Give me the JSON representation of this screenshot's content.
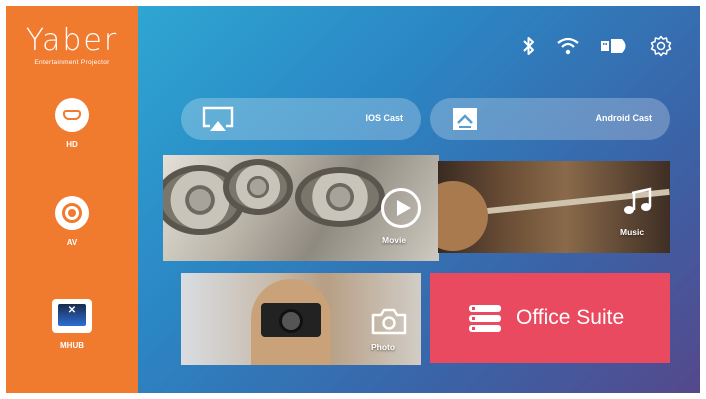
{
  "brand": {
    "name": "Yaber",
    "tagline": "Entertainment Projector",
    "accent_color": "#f07a2e"
  },
  "sidebar": {
    "items": [
      {
        "label": "HD",
        "icon": "hdmi-icon"
      },
      {
        "label": "AV",
        "icon": "av-icon"
      },
      {
        "label": "MHUB",
        "icon": "mhub-icon"
      }
    ]
  },
  "status_bar": {
    "icons": [
      "bluetooth-icon",
      "wifi-icon",
      "input-source-icon",
      "settings-gear-icon"
    ]
  },
  "cast": {
    "ios_label": "IOS Cast",
    "android_label": "Android Cast"
  },
  "tiles": {
    "movie": "Movie",
    "music": "Music",
    "photo": "Photo",
    "office": "Office Suite",
    "office_color": "#e94a5f"
  }
}
